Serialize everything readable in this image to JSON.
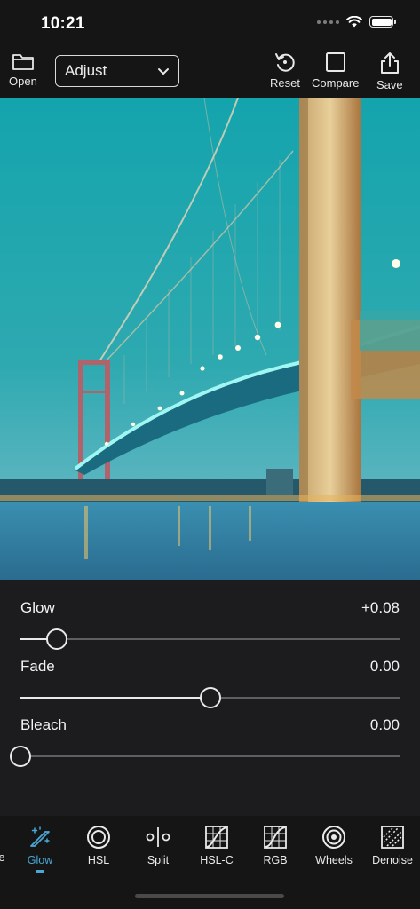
{
  "status_bar": {
    "time": "10:21"
  },
  "toolbar": {
    "open_label": "Open",
    "mode_select": "Adjust",
    "reset_label": "Reset",
    "compare_label": "Compare",
    "save_label": "Save"
  },
  "sliders": [
    {
      "label": "Glow",
      "value": "+0.08",
      "position": 0.095
    },
    {
      "label": "Fade",
      "value": "0.00",
      "position": 0.5
    },
    {
      "label": "Bleach",
      "value": "0.00",
      "position": 0.0
    }
  ],
  "tabs": {
    "partial_label": "e",
    "items": [
      {
        "label": "Glow",
        "icon": "glow-wand-icon",
        "active": true
      },
      {
        "label": "HSL",
        "icon": "hsl-rings-icon"
      },
      {
        "label": "Split",
        "icon": "split-toning-icon"
      },
      {
        "label": "HSL-C",
        "icon": "hsl-curve-icon"
      },
      {
        "label": "RGB",
        "icon": "rgb-curve-icon"
      },
      {
        "label": "Wheels",
        "icon": "color-wheels-icon"
      },
      {
        "label": "Denoise",
        "icon": "denoise-icon"
      }
    ]
  },
  "colors": {
    "accent": "#4aa7d6",
    "background": "#1c1c1e",
    "bar": "#151515"
  }
}
